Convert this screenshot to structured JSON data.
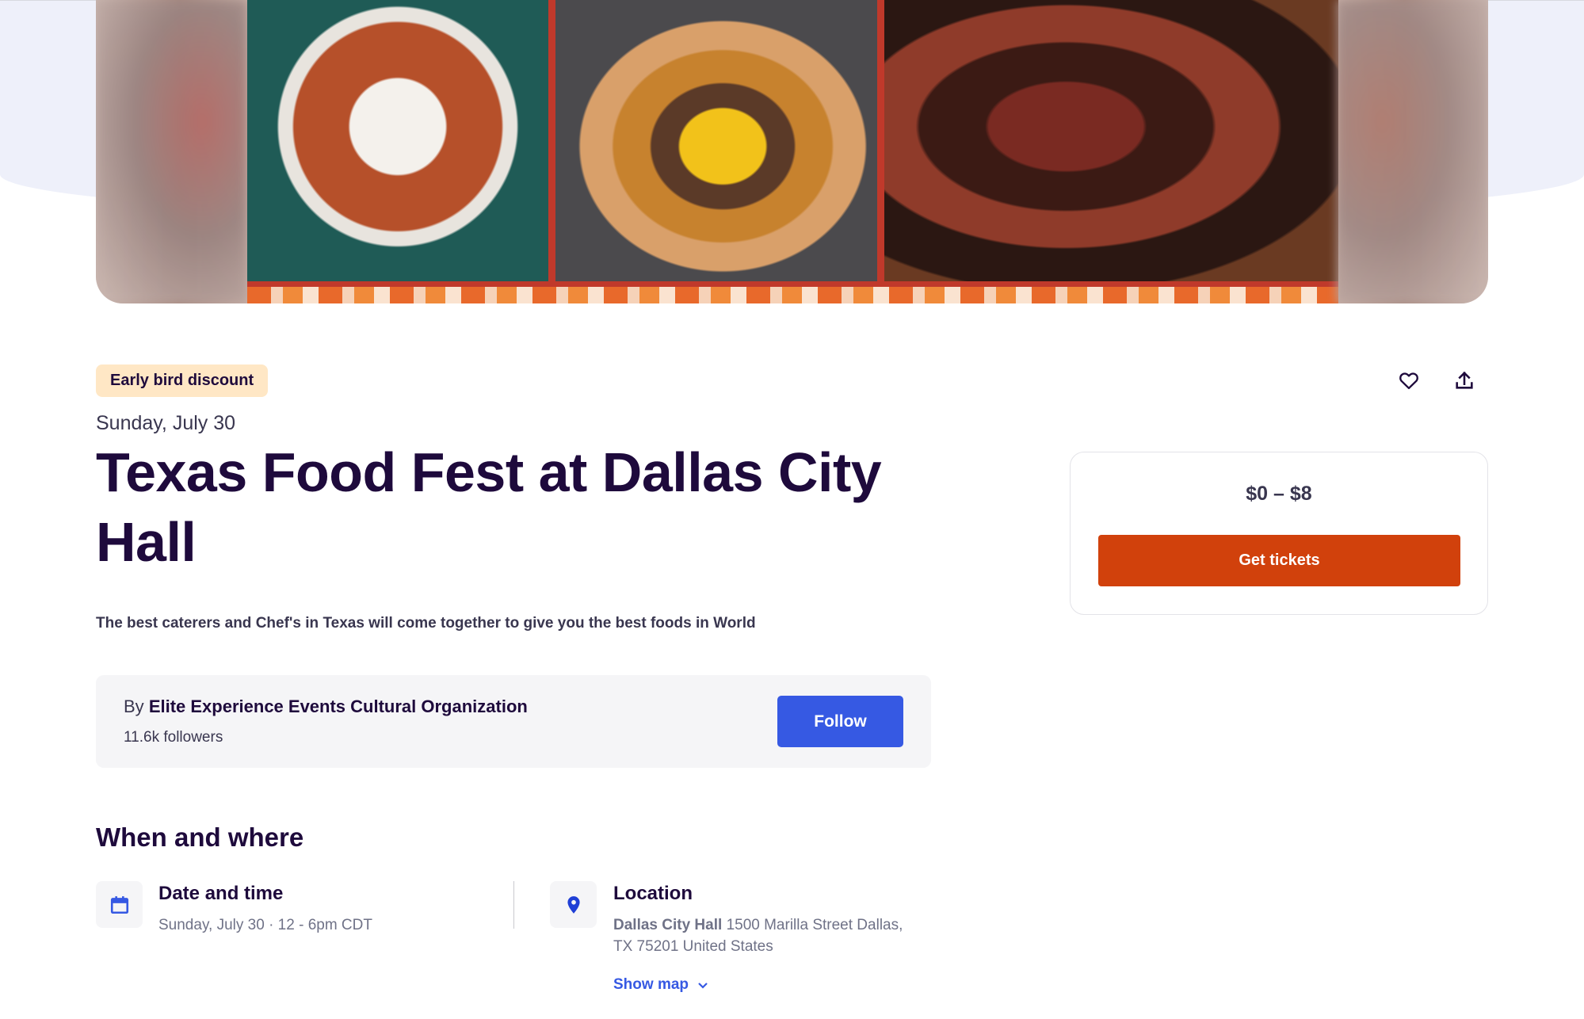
{
  "badge": "Early bird discount",
  "event": {
    "date": "Sunday, July 30",
    "title": "Texas Food Fest at Dallas City Hall",
    "summary": "The best caterers and Chef's in Texas will come together to give you the best foods in World"
  },
  "organizer": {
    "by_prefix": "By",
    "name": "Elite Experience Events Cultural Organization",
    "followers": "11.6k followers",
    "follow_label": "Follow"
  },
  "tickets": {
    "price": "$0 – $8",
    "button_label": "Get tickets"
  },
  "when_where": {
    "section_title": "When and where",
    "date_time": {
      "heading": "Date and time",
      "value": "Sunday, July 30 · 12 - 6pm CDT"
    },
    "location": {
      "heading": "Location",
      "venue": "Dallas City Hall",
      "address_line1": "1500 Marilla Street Dallas,",
      "address_line2": "TX 75201 United States",
      "show_map_label": "Show map"
    }
  },
  "icons": {
    "like": "heart-icon",
    "share": "share-icon",
    "calendar": "calendar-icon",
    "location": "map-pin-icon",
    "chevron": "chevron-down-icon"
  },
  "colors": {
    "brand_orange": "#d1410c",
    "follow_blue": "#3659e3",
    "badge_bg": "#ffe7c5",
    "heading": "#1e0a3c"
  }
}
